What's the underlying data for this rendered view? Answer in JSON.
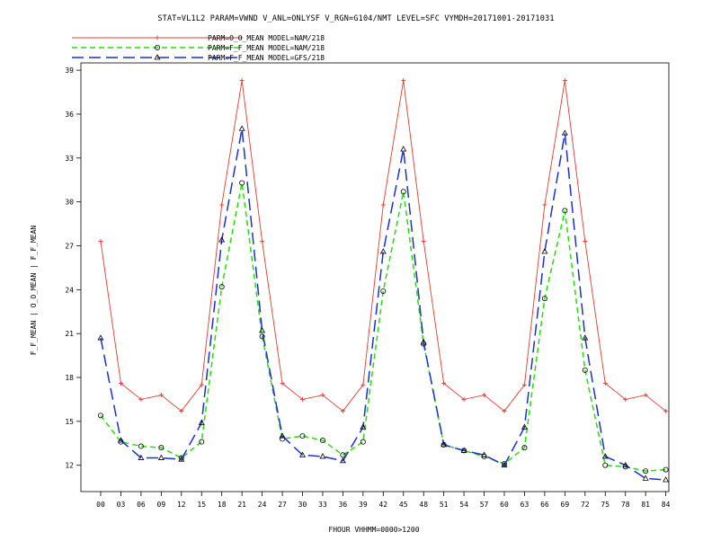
{
  "chart_data": {
    "type": "line",
    "title": "STAT=VL1L2 PARAM=VWND V_ANL=ONLYSF V_RGN=G104/NMT LEVEL=SFC VYMDH=20171001-20171031",
    "xlabel": "FHOUR VHHMM=0000>1200",
    "ylabel": "F_F_MEAN | O_O_MEAN | F_F_MEAN",
    "ylim": [
      10.2,
      39.5
    ],
    "yticks": [
      12,
      15,
      18,
      21,
      24,
      27,
      30,
      33,
      36,
      39
    ],
    "grid": false,
    "legend_position": "top-left",
    "categories": [
      "00",
      "03",
      "06",
      "09",
      "12",
      "15",
      "18",
      "21",
      "24",
      "27",
      "30",
      "33",
      "36",
      "39",
      "42",
      "45",
      "48",
      "51",
      "54",
      "57",
      "60",
      "63",
      "66",
      "69",
      "72",
      "75",
      "78",
      "81",
      "84"
    ],
    "series": [
      {
        "name": "PARM=O_O_MEAN MODEL=NAM/218",
        "color": "#e8392f",
        "dash": "solid",
        "marker": "plus",
        "values": [
          27.3,
          17.6,
          16.5,
          16.8,
          15.7,
          17.5,
          29.8,
          38.3,
          27.3,
          17.6,
          16.5,
          16.8,
          15.7,
          17.5,
          29.8,
          38.3,
          27.3,
          17.6,
          16.5,
          16.8,
          15.7,
          17.5,
          29.8,
          38.3,
          27.3,
          17.6,
          16.5,
          16.8,
          15.7
        ]
      },
      {
        "name": "PARM=F_F_MEAN MODEL=NAM/218",
        "color": "#22e000",
        "dash": "dashed",
        "marker": "circle",
        "values": [
          15.4,
          13.6,
          13.3,
          13.2,
          12.5,
          13.6,
          24.2,
          31.3,
          20.8,
          13.8,
          14.0,
          13.7,
          12.7,
          13.6,
          23.9,
          30.7,
          20.3,
          13.4,
          13.0,
          12.6,
          12.1,
          13.2,
          23.4,
          29.4,
          18.5,
          12.0,
          11.9,
          11.6,
          11.7
        ]
      },
      {
        "name": "PARM=F_F_MEAN MODEL=GFS/218",
        "color": "#1a2fd6",
        "dash": "longdash",
        "marker": "triangle",
        "values": [
          20.7,
          13.7,
          12.5,
          12.5,
          12.4,
          14.9,
          27.4,
          35.0,
          21.2,
          14.0,
          12.7,
          12.6,
          12.3,
          14.6,
          26.6,
          33.6,
          20.4,
          13.4,
          13.0,
          12.7,
          12.0,
          14.6,
          26.6,
          34.7,
          20.7,
          12.6,
          12.0,
          11.1,
          11.0
        ]
      }
    ]
  }
}
